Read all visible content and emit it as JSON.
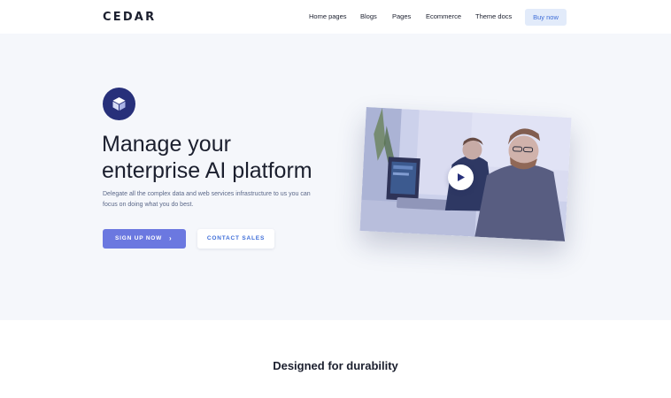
{
  "nav": {
    "logo": "CEDAR",
    "links": [
      "Home pages",
      "Blogs",
      "Pages",
      "Ecommerce",
      "Theme docs"
    ],
    "cta": "Buy now"
  },
  "hero": {
    "badge_icon": "cube-icon",
    "title_line1": "Manage your",
    "title_line2": "enterprise AI platform",
    "description": "Delegate all the complex data and web services infrastructure to us you can focus on doing what you do best.",
    "primary_cta": "SIGN UP NOW",
    "primary_cta_icon": "chevron-right-icon",
    "secondary_cta": "CONTACT SALES",
    "video_icon": "play-icon"
  },
  "features": {
    "title": "Designed for durability"
  },
  "colors": {
    "primary": "#6b78e0",
    "accent_blue": "#3f6ed8",
    "badge": "#27307a",
    "hero_bg": "#f5f7fb"
  }
}
